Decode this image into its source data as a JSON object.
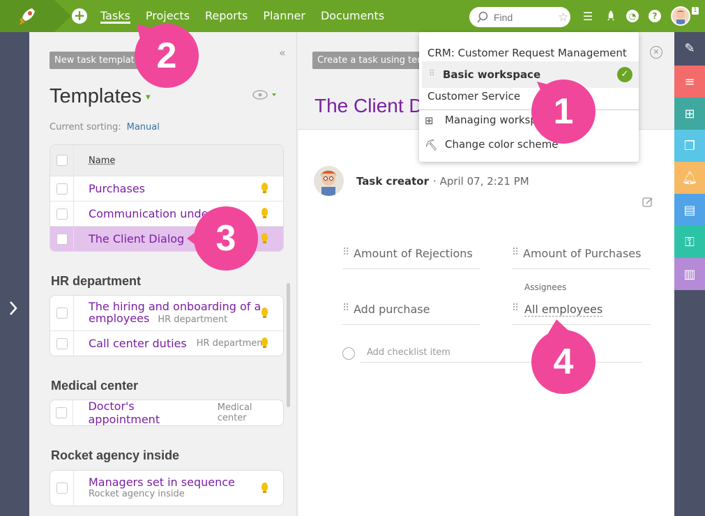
{
  "topbar": {
    "nav": [
      "Tasks",
      "Projects",
      "Reports",
      "Planner",
      "Documents"
    ],
    "active_nav": "Tasks",
    "search_placeholder": "Find",
    "notification_count": "1",
    "colors": {
      "bar": "#6aa527",
      "logo_bg": "#5c9422"
    }
  },
  "sidebar": {
    "new_template_button": "New task template",
    "title": "Templates",
    "sorting_label": "Current sorting:",
    "sorting_value": "Manual",
    "table_header": "Name",
    "templates": [
      {
        "label": "Purchases"
      },
      {
        "label": "Communication under"
      },
      {
        "label": "The Client Dialog",
        "selected": true
      }
    ],
    "groups": [
      {
        "title": "HR department",
        "items": [
          {
            "label": "The hiring and onboarding of a",
            "label2": "employees",
            "sub": "HR department"
          },
          {
            "label": "Call center duties",
            "sub": "HR department"
          }
        ]
      },
      {
        "title": "Medical center",
        "items": [
          {
            "label": "Doctor's appointment",
            "sub": "Medical center"
          }
        ]
      },
      {
        "title": "Rocket agency inside",
        "items": [
          {
            "label": "Managers set in sequence",
            "sub": "Rocket agency inside"
          }
        ]
      }
    ]
  },
  "main": {
    "create_button": "Create a task using tem",
    "title": "The Client D",
    "creator_label": "Task creator",
    "creator_date": "April 07, 2:21 PM",
    "fields": {
      "rejections": "Amount of Rejections",
      "purchases": "Amount of Purchases",
      "add_purchase": "Add purchase",
      "assignees_label": "Assignees",
      "assignees_value": "All employees"
    },
    "checklist_placeholder": "Add checklist item"
  },
  "dropdown": {
    "items": [
      "CRM: Customer Request Management",
      "Basic workspace",
      "Customer Service"
    ],
    "selected": "Basic workspace",
    "actions": [
      "Managing worksp",
      "Change color scheme"
    ]
  },
  "callouts": [
    "1",
    "2",
    "3",
    "4"
  ],
  "right_strip_colors": [
    "#ffffff00",
    "#f36b6b",
    "#3fa9a0",
    "#59c6e8",
    "#f7b963",
    "#4fa3e6",
    "#2dc3a6",
    "#b58ad6"
  ]
}
